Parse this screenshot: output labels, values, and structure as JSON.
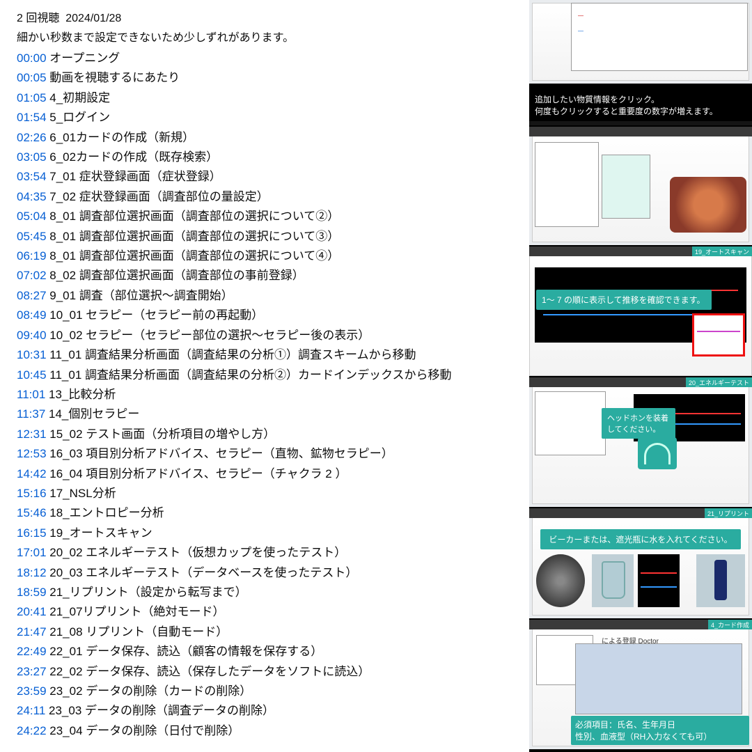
{
  "header": {
    "views": "2 回視聴",
    "date": "2024/01/28",
    "description": "細かい秒数まで設定できないため少しずれがあります。"
  },
  "chapters": [
    {
      "ts": "00:00",
      "label": "オープニング"
    },
    {
      "ts": "00:05",
      "label": "動画を視聴するにあたり"
    },
    {
      "ts": "01:05",
      "label": "4_初期設定"
    },
    {
      "ts": "01:54",
      "label": "5_ログイン"
    },
    {
      "ts": "02:26",
      "label": "6_01カードの作成（新規）"
    },
    {
      "ts": "03:05",
      "label": "6_02カードの作成（既存検索）"
    },
    {
      "ts": "03:54",
      "label": "7_01 症状登録画面（症状登録）"
    },
    {
      "ts": "04:35",
      "label": "7_02 症状登録画面（調査部位の量設定）"
    },
    {
      "ts": "05:04",
      "label": "8_01 調査部位選択画面（調査部位の選択について②）"
    },
    {
      "ts": "05:45",
      "label": "8_01 調査部位選択画面（調査部位の選択について③）"
    },
    {
      "ts": "06:19",
      "label": "8_01 調査部位選択画面（調査部位の選択について④）"
    },
    {
      "ts": "07:02",
      "label": "8_02 調査部位選択画面（調査部位の事前登録）"
    },
    {
      "ts": "08:27",
      "label": "9_01 調査（部位選択～調査開始）"
    },
    {
      "ts": "08:49",
      "label": "10_01 セラピー（セラピー前の再起動）"
    },
    {
      "ts": "09:40",
      "label": "10_02 セラピー（セラピー部位の選択～セラピー後の表示）"
    },
    {
      "ts": "10:31",
      "label": "11_01 調査結果分析画面（調査結果の分析①）調査スキームから移動"
    },
    {
      "ts": "10:45",
      "label": "11_01 調査結果分析画面（調査結果の分析②）カードインデックスから移動"
    },
    {
      "ts": "11:01",
      "label": "13_比較分析"
    },
    {
      "ts": "11:37",
      "label": "14_個別セラピー"
    },
    {
      "ts": "12:31",
      "label": "15_02 テスト画面（分析項目の増やし方）"
    },
    {
      "ts": "12:53",
      "label": "16_03 項目別分析アドバイス、セラピー（直物、鉱物セラピー）"
    },
    {
      "ts": "14:42",
      "label": "16_04 項目別分析アドバイス、セラピー（チャクラ 2 ）"
    },
    {
      "ts": "15:16",
      "label": "17_NSL分析"
    },
    {
      "ts": "15:46",
      "label": "18_エントロピー分析"
    },
    {
      "ts": "16:15",
      "label": "19_オートスキャン"
    },
    {
      "ts": "17:01",
      "label": "20_02 エネルギーテスト（仮想カップを使ったテスト）"
    },
    {
      "ts": "18:12",
      "label": "20_03 エネルギーテスト（データベースを使ったテスト）"
    },
    {
      "ts": "18:59",
      "label": "21_リプリント（設定から転写まで）"
    },
    {
      "ts": "20:41",
      "label": "21_07リプリント（絶対モード）"
    },
    {
      "ts": "21:47",
      "label": "21_08 リプリント（自動モード）"
    },
    {
      "ts": "22:49",
      "label": "22_01 データ保存、読込（顧客の情報を保存する）"
    },
    {
      "ts": "23:27",
      "label": "22_02 データ保存、読込（保存したデータをソフトに読込）"
    },
    {
      "ts": "23:59",
      "label": "23_02 データの削除（カードの削除）"
    },
    {
      "ts": "24:11",
      "label": "23_03 データの削除（調査データの削除）"
    },
    {
      "ts": "24:22",
      "label": "23_04 データの削除（日付で削除）"
    }
  ],
  "thumbs": {
    "t1a": "追加したい物質情報をクリック。",
    "t1b": "何度もクリックすると重要度の数字が増えます。",
    "t3tag": "1～ 7 の順に表示して推移を確認できます。",
    "t4tag": "ヘッドホンを装着してください。",
    "t5tag": "ビーカーまたは、遮光瓶に水を入れてください。",
    "t6a": "必須項目：氏名、生年月日",
    "t6b": "性別、血液型（RH入力なくても可）",
    "doctor": "による登録 Doctor",
    "teal_t3": "19_オートスキャン",
    "teal_t4": "20_エネルギーテスト",
    "teal_t5": "21_リプリント",
    "teal_t6": "4_カード作成"
  }
}
